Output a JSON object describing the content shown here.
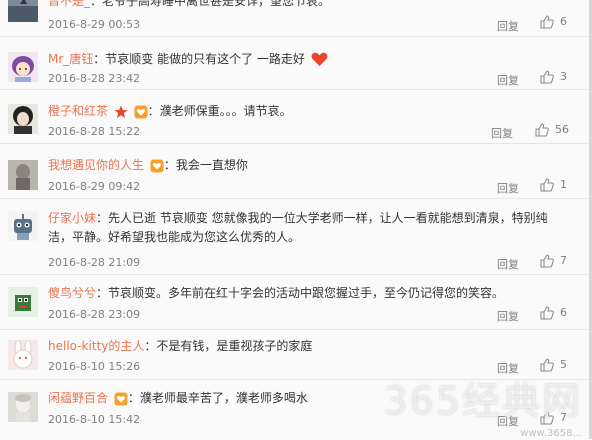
{
  "reply_label": "回复",
  "comments": [
    {
      "username": "晋不是_",
      "text": "：老爷子高寿睡中离世甚是安详，望您节哀。",
      "time": "2016-8-29 00:53",
      "likes": "6",
      "avatar": "sea-photo"
    },
    {
      "username": "Mr_唐钰",
      "text": "：节哀顺变 能做的只有这个了 一路走好",
      "time": "2016-8-28 23:42",
      "likes": "3",
      "avatar": "cartoon-girl",
      "emoji": "heart-icon"
    },
    {
      "username": "橙子和红茶",
      "text": "：濮老师保重。。。请节哀。",
      "time": "2016-8-28 15:22",
      "likes": "56",
      "avatar": "woman-portrait",
      "badges": [
        "star-icon",
        "fan-badge-icon"
      ]
    },
    {
      "username": "我想遇见你的人生",
      "text": "：我会一直想你",
      "time": "2016-8-29 09:42",
      "likes": "1",
      "avatar": "woman-silhouette",
      "badges": [
        "fan-badge-icon"
      ]
    },
    {
      "username": "仔家小妹",
      "text": "：先人已逝 节哀顺变 您就像我的一位大学老师一样，让人一看就能想到清泉，特别纯洁，平静。好希望我也能成为您这么优秀的人。",
      "time": "2016-8-28 21:09",
      "likes": "7",
      "avatar": "cartoon-robot"
    },
    {
      "username": "傻鸟兮兮",
      "text": "：节哀顺变。多年前在红十字会的活动中跟您握过手，至今仍记得您的笑容。",
      "time": "2016-8-28 23:09",
      "likes": "6",
      "avatar": "pixel-creature"
    },
    {
      "username": "hello-kitty的主人",
      "text": "：不是有钱，是重视孩子的家庭",
      "time": "2016-8-10 15:26",
      "likes": "5",
      "avatar": "white-rabbit"
    },
    {
      "username": "闲蕴野百合",
      "text": "：濮老师最辛苦了，濮老师多喝水",
      "time": "2016-8-10 15:42",
      "likes": "7",
      "avatar": "marble-bust",
      "badges": [
        "fan-badge-icon"
      ]
    }
  ],
  "watermark": "365经典网",
  "watermark_url": "www.3658..."
}
